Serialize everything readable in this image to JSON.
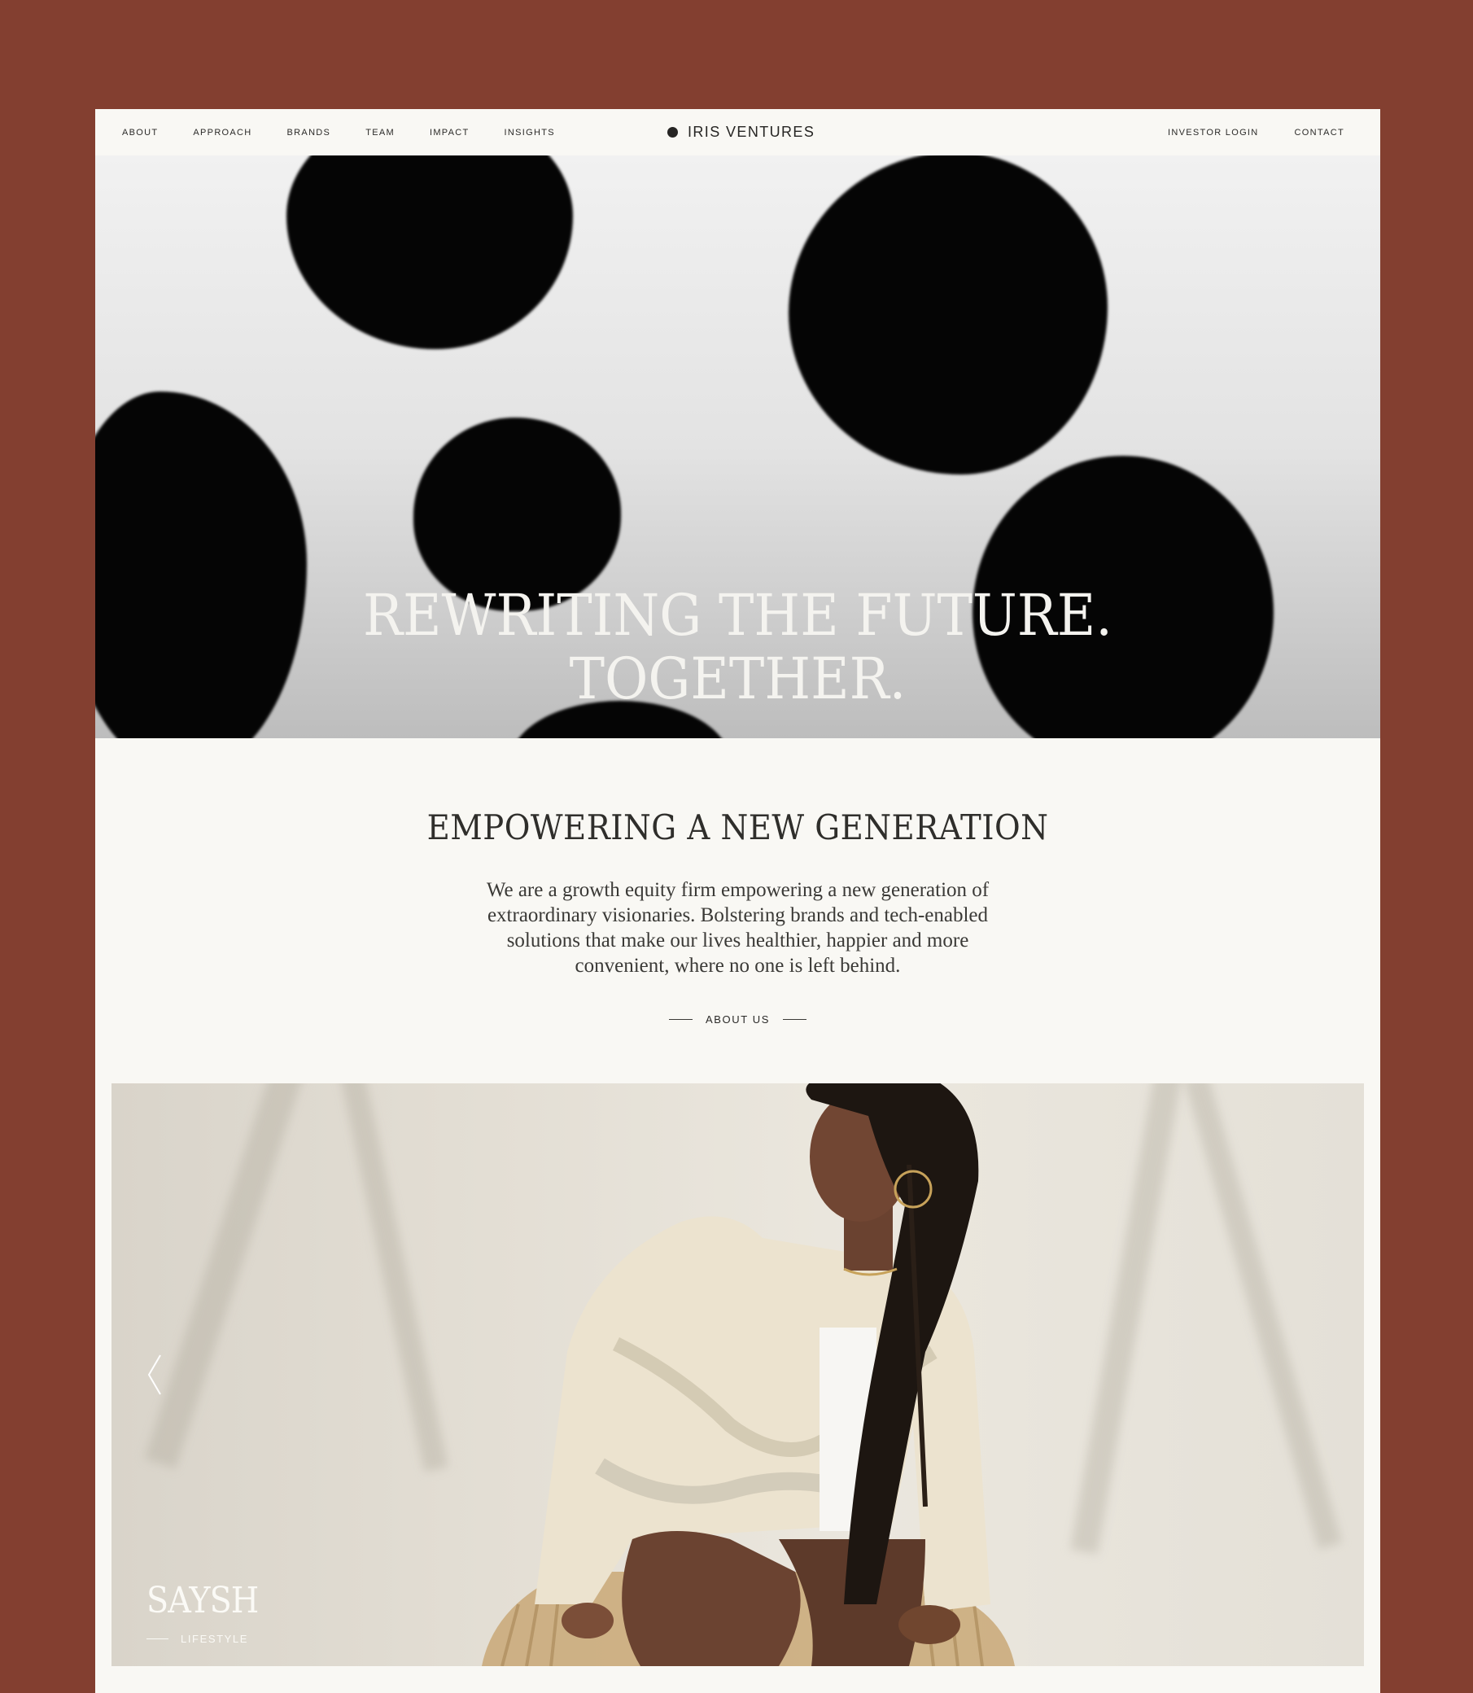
{
  "nav": {
    "links": [
      "ABOUT",
      "APPROACH",
      "BRANDS",
      "TEAM",
      "IMPACT",
      "INSIGHTS"
    ],
    "logo_text": "IRIS VENTURES",
    "investor_login": "INVESTOR LOGIN",
    "contact": "CONTACT"
  },
  "hero": {
    "title_line1": "REWRITING THE FUTURE.",
    "title_line2": "TOGETHER."
  },
  "intro": {
    "title": "EMPOWERING A NEW GENERATION",
    "body": "We are a growth equity firm empowering a new generation of extraordinary visionaries. Bolstering brands and tech-enabled solutions that make our lives healthier, happier and more convenient, where no one is left behind.",
    "cta_label": "ABOUT US"
  },
  "slider": {
    "brand": "SAYSH",
    "category": "LIFESTYLE"
  },
  "colors": {
    "background": "#833f30",
    "page": "#f9f8f4",
    "text": "#2b2a28"
  }
}
